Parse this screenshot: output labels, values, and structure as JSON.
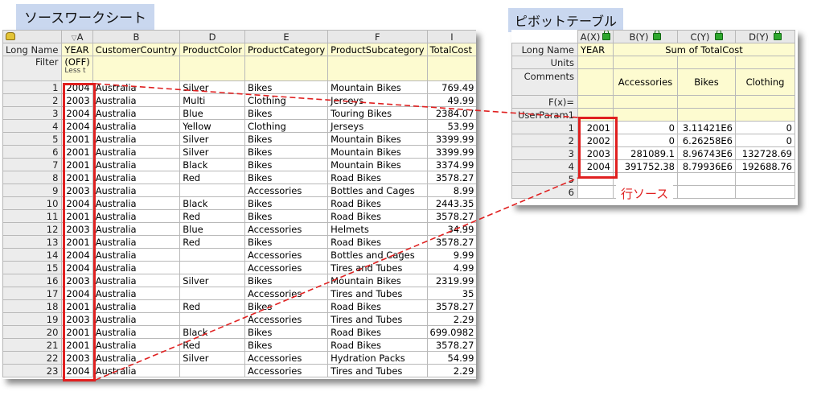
{
  "source": {
    "title": "ソースワークシート",
    "columns": [
      "A",
      "B",
      "D",
      "E",
      "F",
      "I"
    ],
    "long_names": [
      "YEAR",
      "CustomerCountry",
      "ProductColor",
      "ProductCategory",
      "ProductSubcategory",
      "TotalCost"
    ],
    "row_labels": {
      "long_name": "Long Name",
      "filter": "Filter"
    },
    "filter_text": "(OFF)",
    "filter_hint": "Less t",
    "rows": [
      [
        "1",
        "2004",
        "Australia",
        "Silver",
        "Bikes",
        "Mountain Bikes",
        "769.49"
      ],
      [
        "2",
        "2003",
        "Australia",
        "Multi",
        "Clothing",
        "Jerseys",
        "49.99"
      ],
      [
        "3",
        "2004",
        "Australia",
        "Blue",
        "Bikes",
        "Touring Bikes",
        "2384.07"
      ],
      [
        "4",
        "2004",
        "Australia",
        "Yellow",
        "Clothing",
        "Jerseys",
        "53.99"
      ],
      [
        "5",
        "2001",
        "Australia",
        "Silver",
        "Bikes",
        "Mountain Bikes",
        "3399.99"
      ],
      [
        "6",
        "2001",
        "Australia",
        "Silver",
        "Bikes",
        "Mountain Bikes",
        "3399.99"
      ],
      [
        "7",
        "2001",
        "Australia",
        "Black",
        "Bikes",
        "Mountain Bikes",
        "3374.99"
      ],
      [
        "8",
        "2001",
        "Australia",
        "Red",
        "Bikes",
        "Road Bikes",
        "3578.27"
      ],
      [
        "9",
        "2003",
        "Australia",
        "",
        "Accessories",
        "Bottles and Cages",
        "8.99"
      ],
      [
        "10",
        "2004",
        "Australia",
        "Black",
        "Bikes",
        "Road Bikes",
        "2443.35"
      ],
      [
        "11",
        "2001",
        "Australia",
        "Red",
        "Bikes",
        "Road Bikes",
        "3578.27"
      ],
      [
        "12",
        "2003",
        "Australia",
        "Blue",
        "Accessories",
        "Helmets",
        "34.99"
      ],
      [
        "13",
        "2001",
        "Australia",
        "Red",
        "Bikes",
        "Road Bikes",
        "3578.27"
      ],
      [
        "14",
        "2004",
        "Australia",
        "",
        "Accessories",
        "Bottles and Cages",
        "9.99"
      ],
      [
        "15",
        "2004",
        "Australia",
        "",
        "Accessories",
        "Tires and Tubes",
        "4.99"
      ],
      [
        "16",
        "2003",
        "Australia",
        "Silver",
        "Bikes",
        "Mountain Bikes",
        "2319.99"
      ],
      [
        "17",
        "2004",
        "Australia",
        "",
        "Accessories",
        "Tires and Tubes",
        "35"
      ],
      [
        "18",
        "2001",
        "Australia",
        "Red",
        "Bikes",
        "Road Bikes",
        "3578.27"
      ],
      [
        "19",
        "2003",
        "Australia",
        "",
        "Accessories",
        "Tires and Tubes",
        "2.29"
      ],
      [
        "20",
        "2001",
        "Australia",
        "Black",
        "Bikes",
        "Road Bikes",
        "699.0982"
      ],
      [
        "21",
        "2001",
        "Australia",
        "Red",
        "Bikes",
        "Road Bikes",
        "3578.27"
      ],
      [
        "22",
        "2003",
        "Australia",
        "Silver",
        "Accessories",
        "Hydration Packs",
        "54.99"
      ],
      [
        "23",
        "2004",
        "Australia",
        "",
        "Accessories",
        "Tires and Tubes",
        "2.29"
      ]
    ]
  },
  "pivot": {
    "title": "ピボットテーブル",
    "columns": [
      "A(X)",
      "B(Y)",
      "C(Y)",
      "D(Y)"
    ],
    "row_labels": [
      "Long Name",
      "Units",
      "Comments",
      "F(x)=",
      "UserParam1"
    ],
    "year_label": "YEAR",
    "sum_label": "Sum of TotalCost",
    "categories": [
      "Accessories",
      "Bikes",
      "Clothing"
    ],
    "rows": [
      [
        "1",
        "2001",
        "0",
        "3.11421E6",
        "0"
      ],
      [
        "2",
        "2002",
        "0",
        "6.26258E6",
        "0"
      ],
      [
        "3",
        "2003",
        "281089.1",
        "8.96743E6",
        "132728.69"
      ],
      [
        "4",
        "2004",
        "391752.38",
        "8.79936E6",
        "192688.76"
      ]
    ],
    "empty_rows": [
      "5",
      "6"
    ]
  },
  "annotation": {
    "row_source": "行ソース",
    "color": "#e02020"
  }
}
